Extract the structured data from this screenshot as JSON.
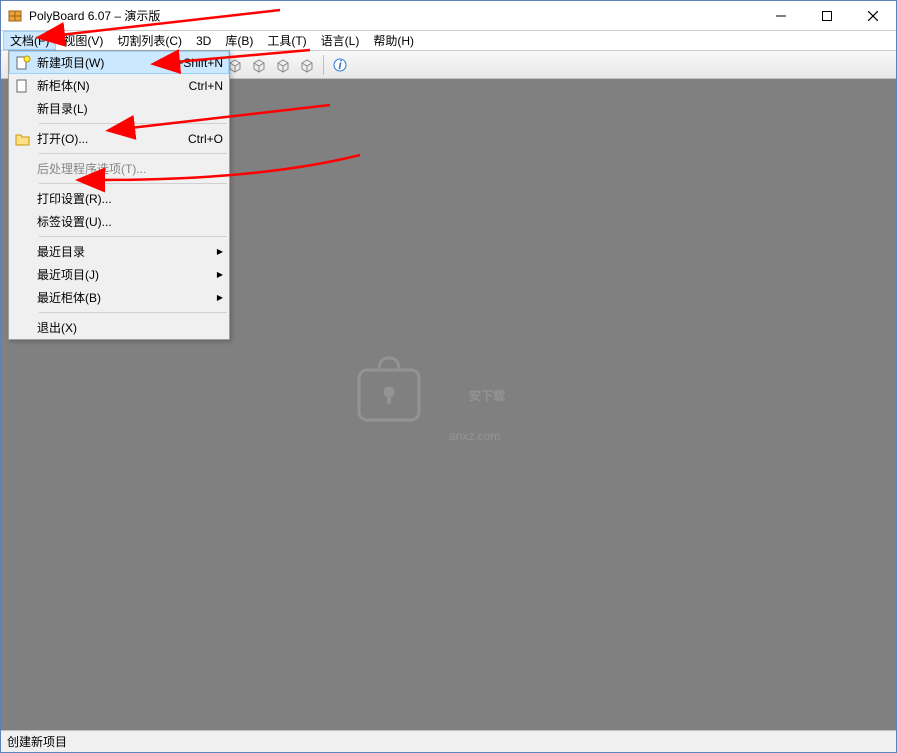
{
  "window": {
    "title": "PolyBoard 6.07 – 演示版"
  },
  "menubar": {
    "items": [
      {
        "label": "文档(F)",
        "open": true
      },
      {
        "label": "视图(V)"
      },
      {
        "label": "切割列表(C)"
      },
      {
        "label": "3D"
      },
      {
        "label": "库(B)"
      },
      {
        "label": "工具(T)"
      },
      {
        "label": "语言(L)"
      },
      {
        "label": "帮助(H)"
      }
    ]
  },
  "dropdown": {
    "items": [
      {
        "icon": "new-doc",
        "label": "新建项目(W)",
        "shortcut": "Ctrl+Shift+N",
        "highlighted": true
      },
      {
        "icon": "new-cab",
        "label": "新柜体(N)",
        "shortcut": "Ctrl+N"
      },
      {
        "icon": "",
        "label": "新目录(L)",
        "shortcut": ""
      },
      {
        "sep": true
      },
      {
        "icon": "open",
        "label": "打开(O)...",
        "shortcut": "Ctrl+O"
      },
      {
        "sep": true
      },
      {
        "icon": "",
        "label": "后处理程序选项(T)...",
        "shortcut": "",
        "disabled": true
      },
      {
        "sep": true
      },
      {
        "icon": "",
        "label": "打印设置(R)...",
        "shortcut": ""
      },
      {
        "icon": "",
        "label": "标签设置(U)...",
        "shortcut": ""
      },
      {
        "sep": true
      },
      {
        "icon": "",
        "label": "最近目录",
        "shortcut": "",
        "submenu": true
      },
      {
        "icon": "",
        "label": "最近项目(J)",
        "shortcut": "",
        "submenu": true
      },
      {
        "icon": "",
        "label": "最近柜体(B)",
        "shortcut": "",
        "submenu": true
      },
      {
        "sep": true
      },
      {
        "icon": "",
        "label": "退出(X)",
        "shortcut": ""
      }
    ]
  },
  "statusbar": {
    "text": "创建新项目"
  },
  "watermark": {
    "line1": "安下载",
    "line2": "anxz.com"
  }
}
